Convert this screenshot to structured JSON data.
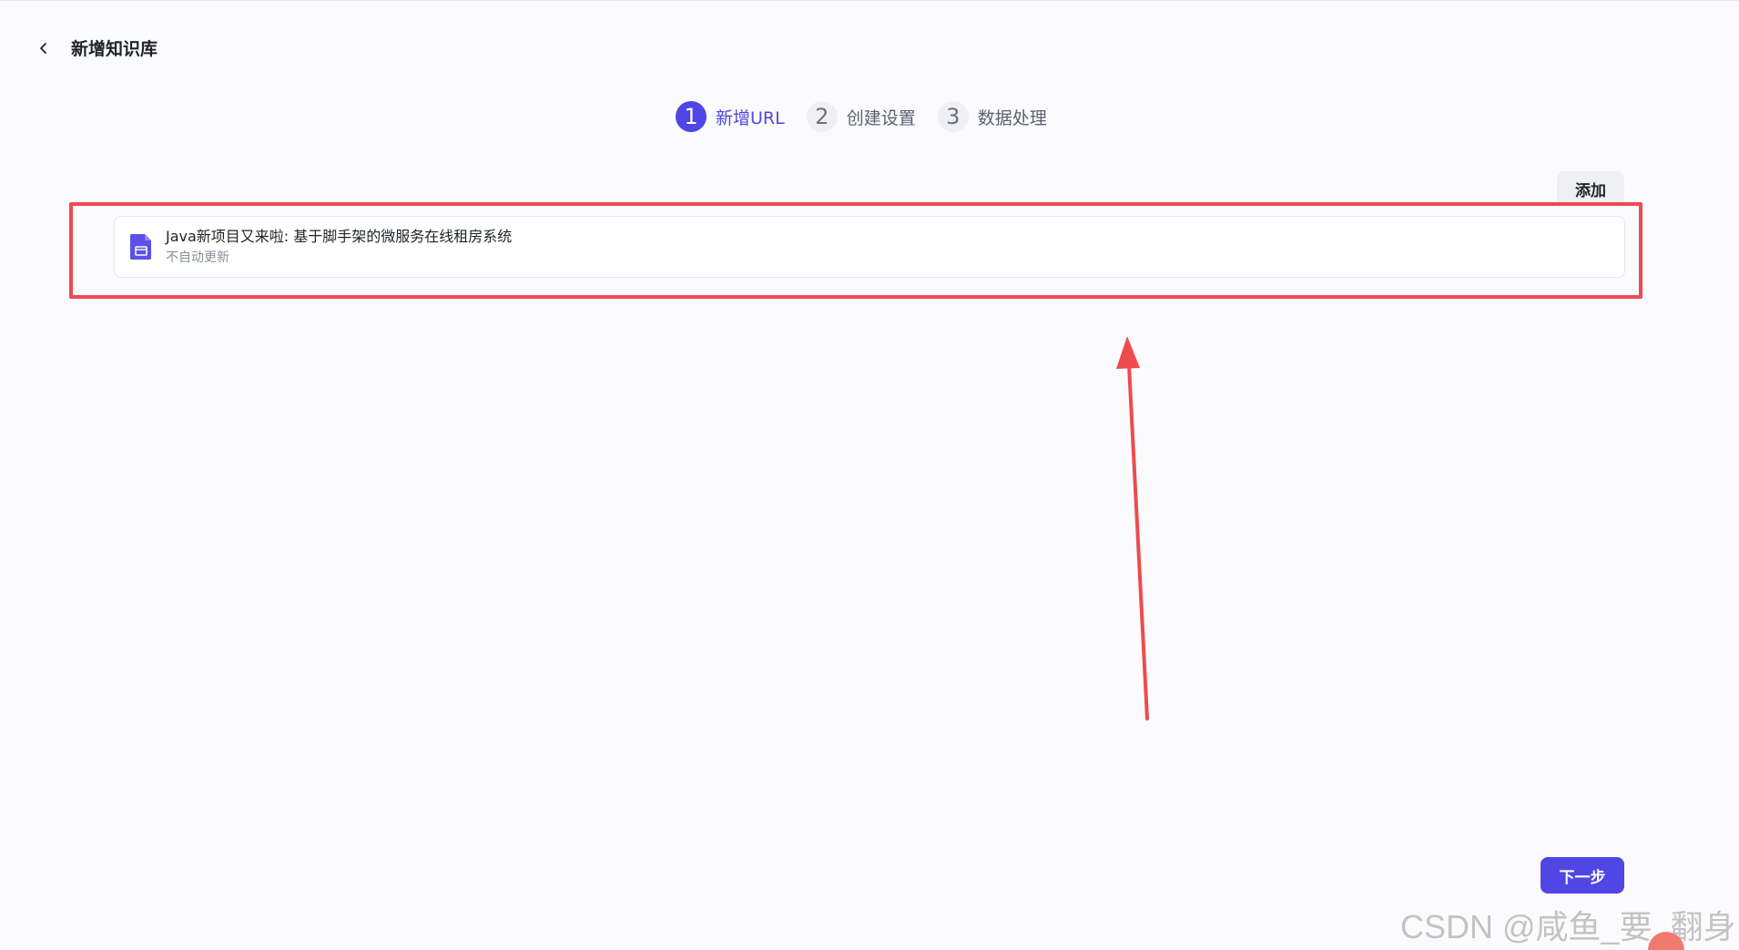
{
  "header": {
    "back_icon": "chevron-left-icon",
    "title": "新增知识库"
  },
  "stepper": {
    "steps": [
      {
        "number": "1",
        "label": "新增URL",
        "state": "active"
      },
      {
        "number": "2",
        "label": "创建设置",
        "state": "inactive"
      },
      {
        "number": "3",
        "label": "数据处理",
        "state": "inactive"
      }
    ]
  },
  "toolbar": {
    "add_label": "添加"
  },
  "url_list": [
    {
      "icon": "document-icon",
      "title": "Java新项目又来啦: 基于脚手架的微服务在线租房系统",
      "subtitle": "不自动更新"
    }
  ],
  "footer": {
    "next_label": "下一步"
  },
  "watermark": {
    "text": "CSDN @咸鱼_要_翻身"
  },
  "colors": {
    "accent": "#4f46e5",
    "annotation_red": "#ee4b4f",
    "background": "#fbfbfd"
  }
}
